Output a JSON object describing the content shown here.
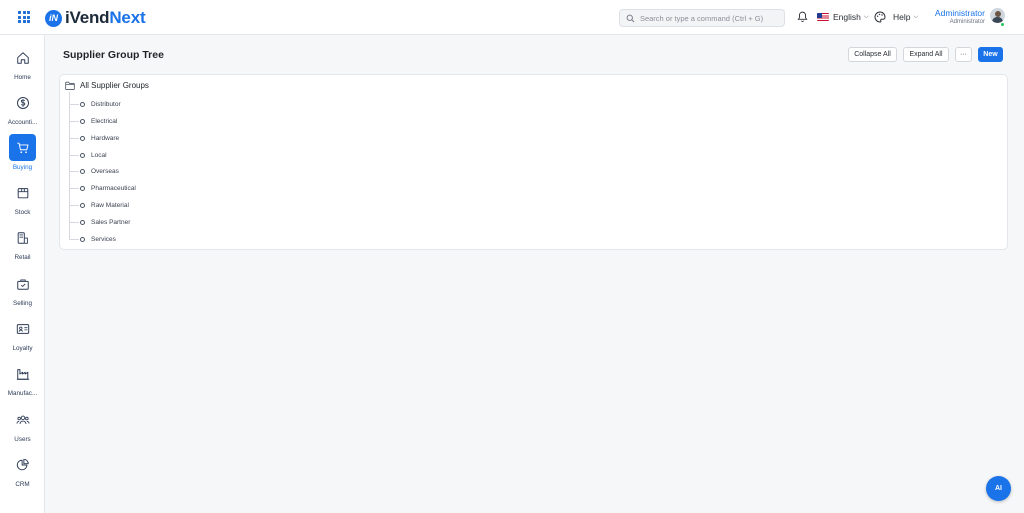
{
  "app": {
    "logo_prefix": "iVend",
    "logo_suffix": "Next",
    "logo_mark": "iN"
  },
  "header": {
    "search_placeholder": "Search or type a command (Ctrl + G)",
    "language": "English",
    "help": "Help",
    "user_name": "Administrator",
    "user_role": "Administrator"
  },
  "sidebar": {
    "items": [
      {
        "label": "Home",
        "icon": "home-icon"
      },
      {
        "label": "Accounti...",
        "icon": "dollar-icon"
      },
      {
        "label": "Buying",
        "icon": "cart-icon",
        "active": true
      },
      {
        "label": "Stock",
        "icon": "box-icon"
      },
      {
        "label": "Retail",
        "icon": "pos-icon"
      },
      {
        "label": "Selling",
        "icon": "shop-icon"
      },
      {
        "label": "Loyalty",
        "icon": "card-icon"
      },
      {
        "label": "Manufac...",
        "icon": "factory-icon"
      },
      {
        "label": "Users",
        "icon": "users-icon"
      },
      {
        "label": "CRM",
        "icon": "pie-icon"
      }
    ]
  },
  "page": {
    "title": "Supplier Group Tree",
    "collapse_all": "Collapse All",
    "expand_all": "Expand All",
    "more": "···",
    "new": "New"
  },
  "tree": {
    "root": "All Supplier Groups",
    "children": [
      "Distributor",
      "Electrical",
      "Hardware",
      "Local",
      "Overseas",
      "Pharmaceutical",
      "Raw Material",
      "Sales Partner",
      "Services"
    ]
  },
  "assistant": {
    "label": "AI"
  },
  "colors": {
    "accent": "#1a73e8",
    "online": "#22c55e"
  }
}
